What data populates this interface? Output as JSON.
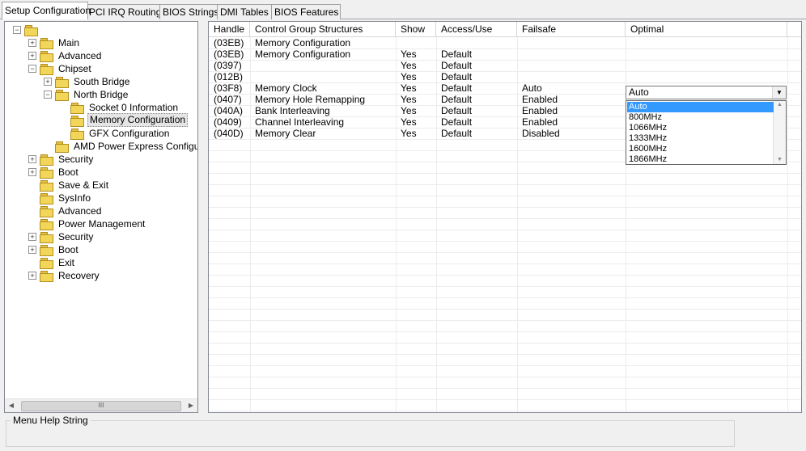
{
  "tabs": [
    "Setup Configuration",
    "PCI IRQ Routing",
    "BIOS Strings",
    "DMI Tables",
    "BIOS Features"
  ],
  "tree": {
    "items": [
      {
        "label": "",
        "expander": "−"
      },
      {
        "label": "Main",
        "expander": "+"
      },
      {
        "label": "Advanced",
        "expander": "+"
      },
      {
        "label": "Chipset",
        "expander": "−"
      },
      {
        "label": "South Bridge",
        "expander": "+"
      },
      {
        "label": "North Bridge",
        "expander": "−"
      },
      {
        "label": "Socket 0 Information",
        "expander": ""
      },
      {
        "label": "Memory Configuration",
        "expander": ""
      },
      {
        "label": "GFX Configuration",
        "expander": ""
      },
      {
        "label": "AMD Power Express Configuration",
        "expander": ""
      },
      {
        "label": "Security",
        "expander": "+"
      },
      {
        "label": "Boot",
        "expander": "+"
      },
      {
        "label": "Save & Exit",
        "expander": ""
      },
      {
        "label": "SysInfo",
        "expander": ""
      },
      {
        "label": "Advanced",
        "expander": ""
      },
      {
        "label": "Power Management",
        "expander": ""
      },
      {
        "label": "Security",
        "expander": "+"
      },
      {
        "label": "Boot",
        "expander": "+"
      },
      {
        "label": "Exit",
        "expander": ""
      },
      {
        "label": "Recovery",
        "expander": "+"
      }
    ],
    "scroll_left": "◀",
    "scroll_right": "▶",
    "scroll_grip": "III"
  },
  "grid": {
    "columns": [
      "Handle",
      "Control Group Structures",
      "Show",
      "Access/Use",
      "Failsafe",
      "Optimal"
    ],
    "rows": [
      [
        "(03EB)",
        "Memory Configuration",
        "",
        "",
        "",
        ""
      ],
      [
        "(03EB)",
        "Memory Configuration",
        "Yes",
        "Default",
        "",
        ""
      ],
      [
        "(0397)",
        "",
        "Yes",
        "Default",
        "",
        ""
      ],
      [
        "(012B)",
        "",
        "Yes",
        "Default",
        "",
        ""
      ],
      [
        "(03F8)",
        "Memory Clock",
        "Yes",
        "Default",
        "Auto",
        ""
      ],
      [
        "(0407)",
        "Memory Hole Remapping",
        "Yes",
        "Default",
        "Enabled",
        ""
      ],
      [
        "(040A)",
        "Bank Interleaving",
        "Yes",
        "Default",
        "Enabled",
        ""
      ],
      [
        "(0409)",
        "Channel Interleaving",
        "Yes",
        "Default",
        "Enabled",
        ""
      ],
      [
        "(040D)",
        "Memory Clear",
        "Yes",
        "Default",
        "Disabled",
        ""
      ]
    ]
  },
  "optimal_combo": {
    "value": "Auto",
    "arrow": "▼",
    "options": [
      "Auto",
      "800MHz",
      "1066MHz",
      "1333MHz",
      "1600MHz",
      "1866MHz"
    ],
    "selected_index": 0
  },
  "help": {
    "legend": "Menu Help String"
  },
  "colors": {
    "selection": "#3399ff",
    "folder": "#f2d65a"
  }
}
